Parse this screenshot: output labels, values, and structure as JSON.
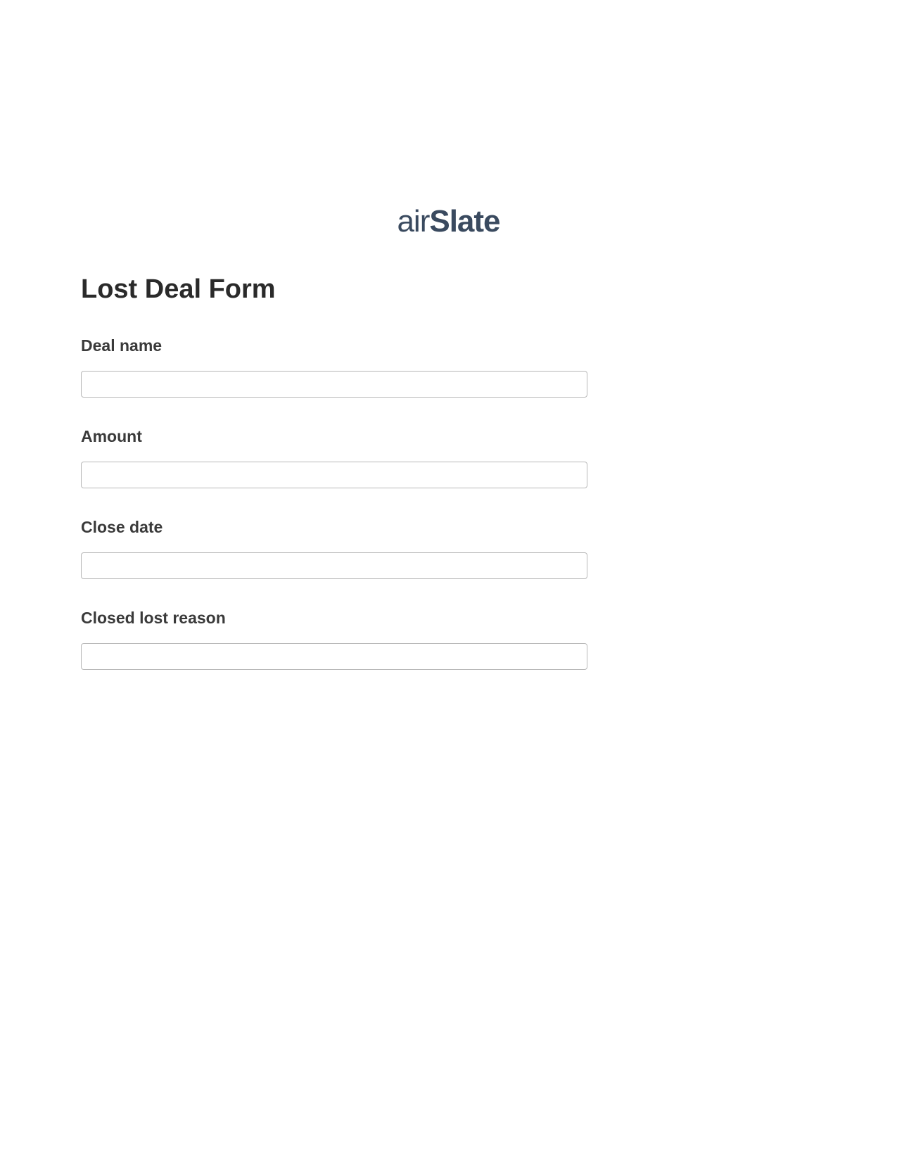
{
  "logo": {
    "part1": "air",
    "part2": "Slate"
  },
  "form": {
    "title": "Lost Deal Form",
    "fields": [
      {
        "label": "Deal name",
        "value": ""
      },
      {
        "label": "Amount",
        "value": ""
      },
      {
        "label": "Close date",
        "value": ""
      },
      {
        "label": "Closed lost reason",
        "value": ""
      }
    ]
  }
}
